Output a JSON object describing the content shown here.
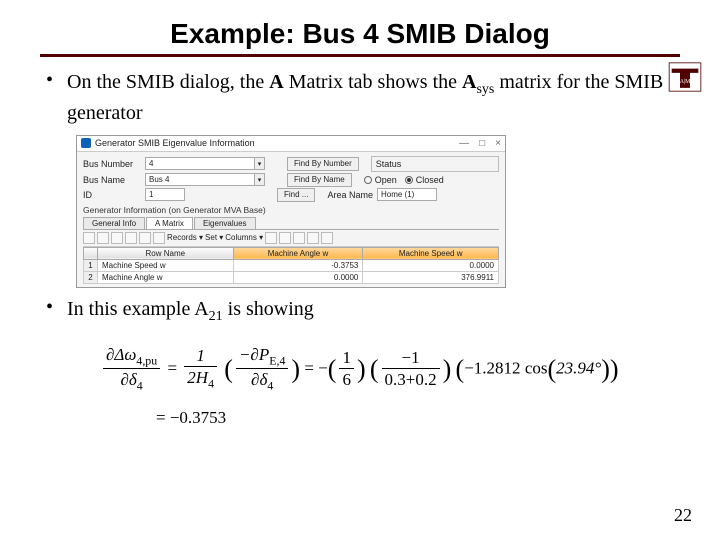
{
  "title": "Example: Bus 4 SMIB Dialog",
  "bullet1_pre": "On the SMIB dialog, the ",
  "bullet1_bold": "A",
  "bullet1_mid": " Matrix tab shows the ",
  "bullet1_A2": "A",
  "bullet1_sub": "sys",
  "bullet1_post": " matrix for the SMIB generator",
  "bullet2_pre": "In this example A",
  "bullet2_sub": "21",
  "bullet2_post": " is showing",
  "dialog": {
    "title": "Generator SMIB Eigenvalue Information",
    "min": "—",
    "max": "□",
    "close": "×",
    "labels": {
      "bus_number": "Bus Number",
      "bus_name": "Bus Name",
      "id": "ID",
      "status": "Status",
      "open": "Open",
      "closed": "Closed",
      "area": "Area Name"
    },
    "values": {
      "bus_number": "4",
      "bus_name": "Bus 4",
      "id": "1",
      "area": "Home (1)"
    },
    "buttons": {
      "find_num": "Find By Number",
      "find_name": "Find By Name",
      "find": "Find ..."
    },
    "section": "Generator Information (on Generator MVA Base)",
    "tabs": [
      "General Info",
      "A Matrix",
      "Eigenvalues"
    ],
    "toolbar": {
      "records": "Records ▾",
      "set": "Set ▾",
      "columns": "Columns ▾"
    },
    "table": {
      "headers": [
        "",
        "Row Name",
        "Machine Angle w",
        "Machine Speed w"
      ],
      "rows": [
        [
          "1",
          "Machine Speed w",
          "-0.3753",
          "0.0000"
        ],
        [
          "2",
          "Machine Angle w",
          "0.0000",
          "376.9911"
        ]
      ]
    }
  },
  "eq": {
    "lhs_top": "∂Δω",
    "lhs_top_sub": "4,pu",
    "lhs_bot": "∂δ",
    "lhs_bot_sub": "4",
    "eq": "=",
    "f1_top": "1",
    "f1_bot_pre": "2H",
    "f1_bot_sub": "4",
    "f2_top_pre": "−∂P",
    "f2_top_sub": "E,4",
    "f2_bot": "∂δ",
    "f2_bot_sub": "4",
    "f3_top": "1",
    "f3_bot": "6",
    "f4_top": "−1",
    "f4_bot": "0.3+0.2",
    "tail_open": "(",
    "tail_num": "−1.2812",
    "tail_cos": "cos",
    "tail_arg_open": "(",
    "tail_deg": "23.94°",
    "tail_arg_close": ")",
    "tail_close": ")",
    "line2": "= −0.3753"
  },
  "pagenum": "22"
}
